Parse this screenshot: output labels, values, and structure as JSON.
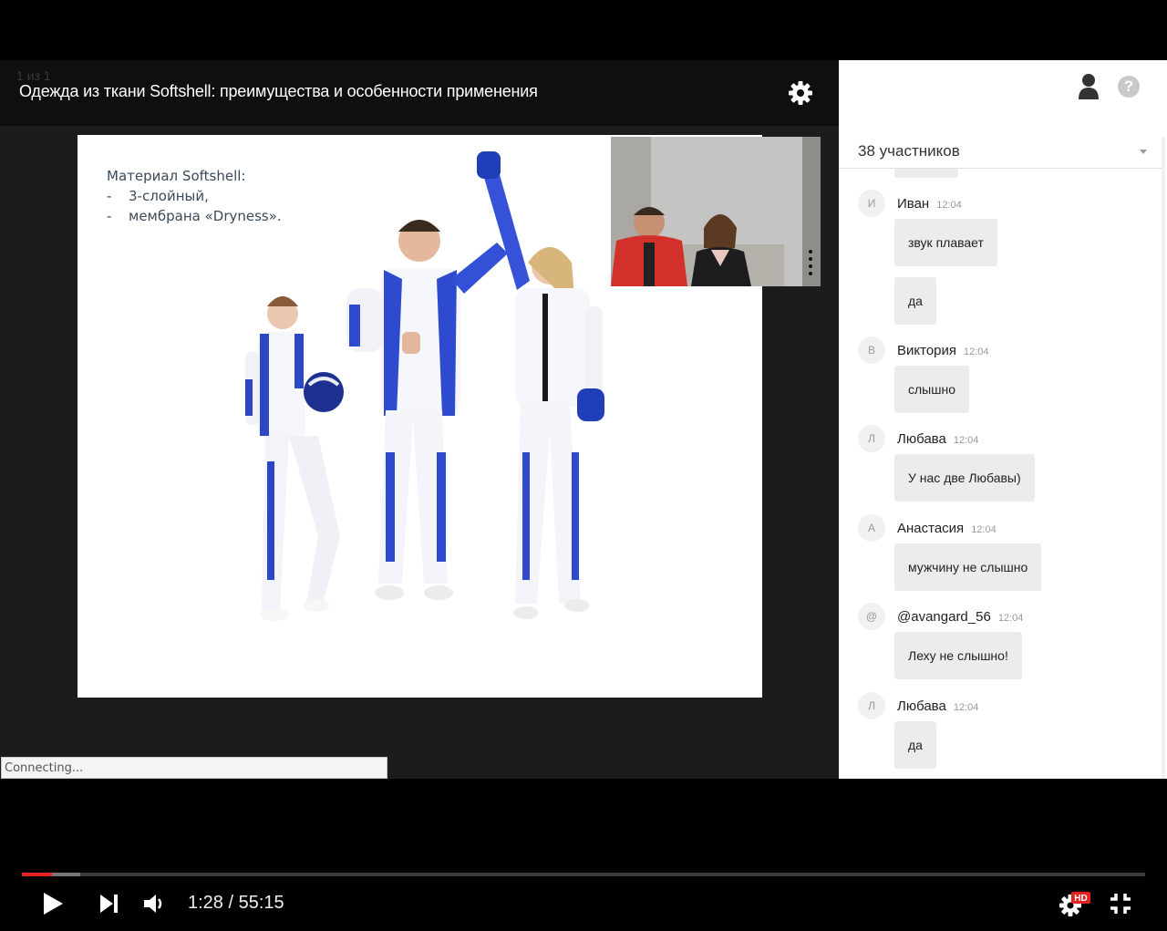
{
  "webinar": {
    "page_counter": "1 из 1",
    "title": "Одежда из ткани Softshell: преимущества и особенности применения"
  },
  "slide": {
    "heading": "Материал Softshell:",
    "items": [
      "3-слойный,",
      "мембрана «Dryness»."
    ]
  },
  "status": {
    "connecting": "Connecting..."
  },
  "sidebar": {
    "participants_label": "38 участников",
    "messages": [
      {
        "initial": "И",
        "author": "Иван",
        "time": "12:04",
        "texts": [
          "звук плавает",
          "да"
        ]
      },
      {
        "initial": "В",
        "author": "Виктория",
        "time": "12:04",
        "texts": [
          "слышно"
        ]
      },
      {
        "initial": "Л",
        "author": "Любава",
        "time": "12:04",
        "texts": [
          "У нас две Любавы)"
        ]
      },
      {
        "initial": "А",
        "author": "Анастасия",
        "time": "12:04",
        "texts": [
          "мужчину не слышно"
        ]
      },
      {
        "initial": "@",
        "author": "@avangard_56",
        "time": "12:04",
        "texts": [
          "Леху не слышно!"
        ]
      },
      {
        "initial": "Л",
        "author": "Любава",
        "time": "12:04",
        "texts": [
          "да"
        ]
      }
    ]
  },
  "player": {
    "current_time": "1:28",
    "duration": "55:15",
    "time_display": "1:28 / 55:15",
    "played_fraction": 0.027,
    "quality_badge": "HD",
    "accent_color": "#e52020"
  }
}
